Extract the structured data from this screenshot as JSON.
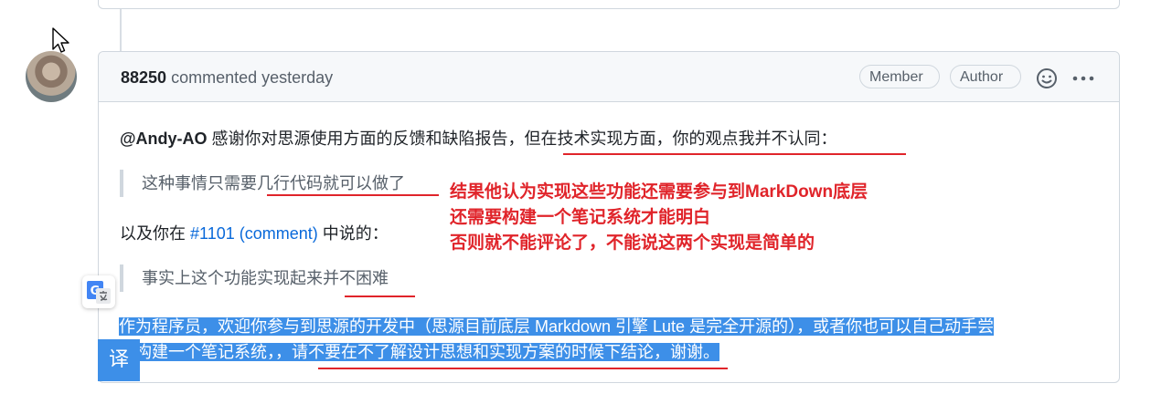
{
  "comment": {
    "author": "88250",
    "action": "commented",
    "time": "yesterday",
    "badges": [
      "Member",
      "Author"
    ],
    "body": {
      "p1_mention": "@Andy-AO",
      "p1_text_a": " 感谢你对思源使用方面的反馈和缺陷报告，",
      "p1_text_b": "但在技术实现方面，你的观点我并不认同：",
      "quote1_a": "这种事情只需要",
      "quote1_b": "几行代码就可以做了",
      "p2_a": "以及你在 ",
      "p2_link": "#1101 (comment)",
      "p2_b": " 中说的：",
      "quote2_a": "事实上这个功能实现起来",
      "quote2_b": "并不困难",
      "p3_line1": "作为程序员，欢迎你参与到思源的开发中（思源目前底层 Markdown 引擎 Lute 是完全开源的），或者你也可以自己动手尝",
      "p3_line2_a": "试构建一个笔记系统，，",
      "p3_line2_b": "请不要在不了解设计思想和实现方案的时候下结论",
      "p3_line2_c": "，谢谢。"
    }
  },
  "annotation": {
    "lines": [
      "结果他认为实现这些功能还需要参与到MarkDown底层",
      "还需要构建一个笔记系统才能明白",
      "否则就不能评论了，不能说这两个实现是简单的"
    ],
    "color": "#e0242a"
  },
  "translate_button": {
    "label": "译"
  },
  "colors": {
    "selection": "#3d8fe8",
    "link": "#0969da"
  }
}
